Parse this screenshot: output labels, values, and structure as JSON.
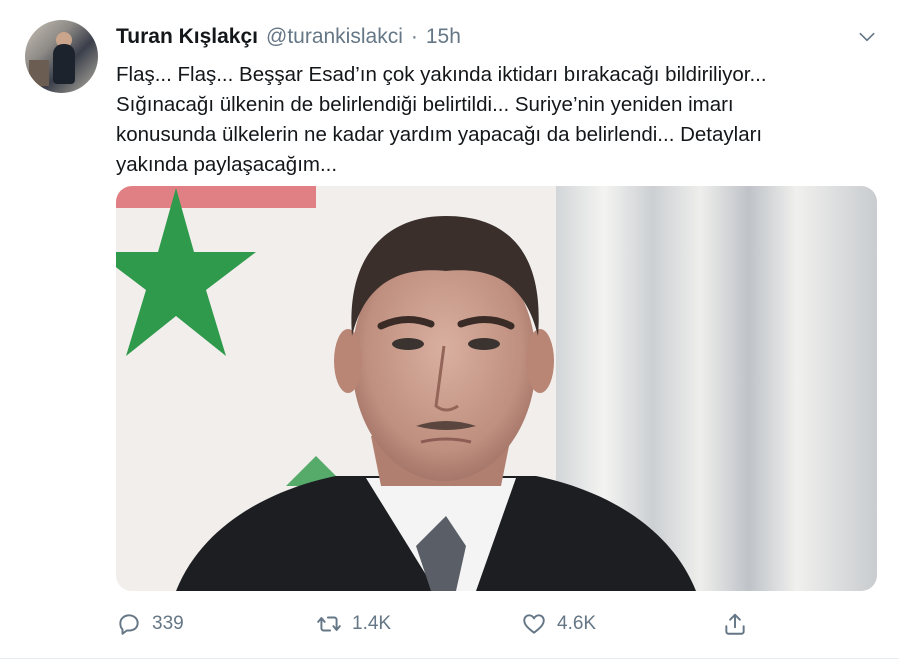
{
  "tweet": {
    "author_name": "Turan Kışlakçı",
    "handle": "@turankislakci",
    "separator": "·",
    "time": "15h",
    "text": "Flaş... Flaş... Beşşar Esad’ın çok yakında iktidarı bırakacağı bildiriliyor...\nSığınacağı ülkenin de belirlendiği belirtildi... Suriye’nin yeniden imarı\nkonusunda ülkelerin ne kadar yardım yapacağı da belirlendi... Detayları\nyakında paylaşacağım..."
  },
  "actions": {
    "reply_count": "339",
    "retweet_count": "1.4K",
    "like_count": "4.6K"
  },
  "icons": {
    "more": "chevron-down-icon",
    "reply": "reply-icon",
    "retweet": "retweet-icon",
    "like": "heart-icon",
    "share": "share-icon"
  },
  "colors": {
    "text_primary": "#14171a",
    "text_secondary": "#657786",
    "flag_green": "#2f9a4b",
    "flag_red": "#d4262f"
  }
}
